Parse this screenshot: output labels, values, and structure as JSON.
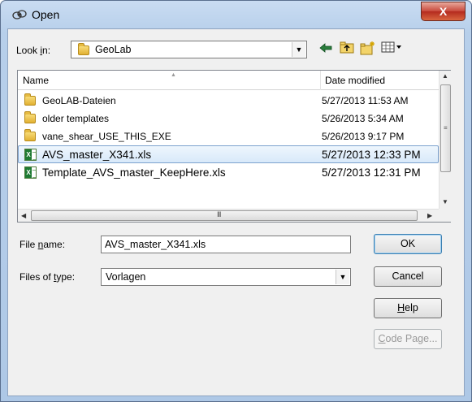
{
  "window": {
    "title": "Open",
    "close_label": "X"
  },
  "lookin": {
    "label_pre": "Look ",
    "label_key": "i",
    "label_post": "n:",
    "value": "GeoLab",
    "arrow": "▼"
  },
  "toolbar": {
    "back_icon": "back-arrow",
    "up_icon": "up-folder",
    "newfolder_icon": "new-folder",
    "views_icon": "views-menu"
  },
  "list": {
    "columns": {
      "name": "Name",
      "date": "Date modified"
    },
    "rows": [
      {
        "type": "folder",
        "name": "GeoLAB-Dateien",
        "date": "5/27/2013 11:53 AM"
      },
      {
        "type": "folder",
        "name": "older templates",
        "date": "5/26/2013 5:34 AM"
      },
      {
        "type": "folder",
        "name": "vane_shear_USE_THIS_EXE",
        "date": "5/26/2013 9:17 PM"
      },
      {
        "type": "xls",
        "name": "AVS_master_X341.xls",
        "date": "5/27/2013 12:33 PM",
        "selected": true
      },
      {
        "type": "xls",
        "name": "Template_AVS_master_KeepHere.xls",
        "date": "5/27/2013 12:31 PM"
      }
    ],
    "hscroll_grip": "III",
    "vscroll_grip": "≡"
  },
  "filename": {
    "label_pre": "File ",
    "label_key": "n",
    "label_post": "ame:",
    "value": "AVS_master_X341.xls"
  },
  "filetype": {
    "label_pre": "Files of ",
    "label_key": "t",
    "label_post": "ype:",
    "value": "Vorlagen",
    "arrow": "▼"
  },
  "buttons": {
    "ok": "OK",
    "cancel": "Cancel",
    "help_key": "H",
    "help_rest": "elp",
    "codepage_key": "C",
    "codepage_rest": "ode Page..."
  },
  "colors": {
    "selection_border": "#7da2ce",
    "title_bg": "#b7cfea",
    "close_red": "#c8483a"
  }
}
